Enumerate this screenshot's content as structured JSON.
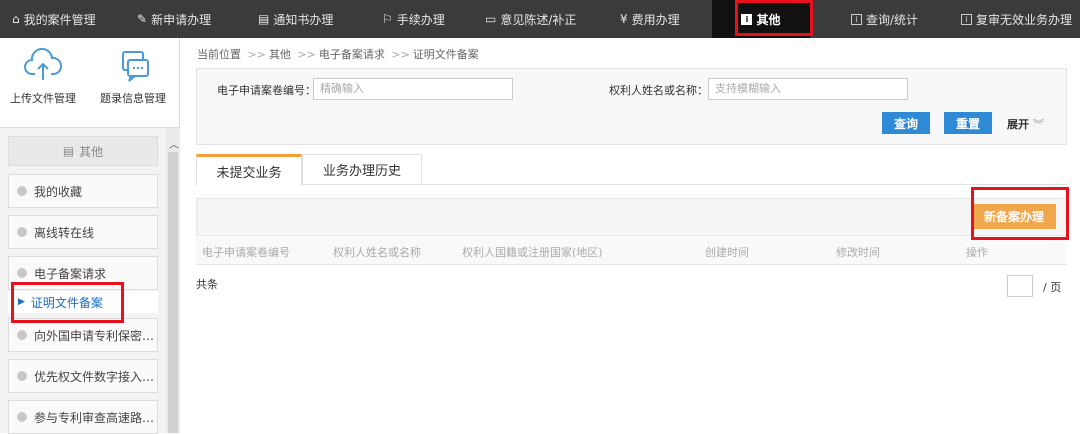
{
  "topnav": {
    "items": [
      {
        "label": "我的案件管理",
        "icon": "home-icon"
      },
      {
        "label": "新申请办理",
        "icon": "edit-icon"
      },
      {
        "label": "通知书办理",
        "icon": "grid-icon"
      },
      {
        "label": "手续办理",
        "icon": "flag-icon"
      },
      {
        "label": "意见陈述/补正",
        "icon": "form-icon"
      },
      {
        "label": "费用办理",
        "icon": "yen-icon"
      },
      {
        "label": "其他",
        "icon": "info-icon"
      },
      {
        "label": "查询/统计",
        "icon": "info-icon"
      },
      {
        "label": "复审无效业务办理",
        "icon": "info-icon"
      }
    ]
  },
  "sidebar": {
    "tools": [
      {
        "label": "上传文件管理",
        "icon": "cloud-upload-icon"
      },
      {
        "label": "题录信息管理",
        "icon": "chat-screen-icon"
      }
    ],
    "section_title": "其他",
    "items": [
      {
        "label": "我的收藏"
      },
      {
        "label": "离线转在线"
      },
      {
        "label": "电子备案请求"
      },
      {
        "label": "向外国申请专利保密…"
      },
      {
        "label": "优先权文件数字接入…"
      },
      {
        "label": "参与专利审查高速路…"
      }
    ],
    "sub_item": "证明文件备案"
  },
  "breadcrumb": {
    "prefix": "当前位置",
    "parts": [
      "其他",
      "电子备案请求",
      "证明文件备案"
    ]
  },
  "search": {
    "field1_label": "电子申请案卷编号：",
    "field1_placeholder": "精确输入",
    "field2_label": "权利人姓名或名称：",
    "field2_placeholder": "支持模糊输入",
    "query_button": "查询",
    "reset_button": "重置",
    "expand_label": "展开"
  },
  "tabs": [
    {
      "label": "未提交业务"
    },
    {
      "label": "业务办理历史"
    }
  ],
  "toolbar": {
    "new_button": "新备案办理"
  },
  "table": {
    "columns": [
      "电子申请案卷编号",
      "权利人姓名或名称",
      "权利人国籍或注册国家(地区)",
      "创建时间",
      "修改时间",
      "操作"
    ]
  },
  "pager": {
    "total": "共条",
    "page_unit": "/ 页"
  },
  "colors": {
    "highlight": "#e8101a",
    "primary": "#2f8ad6",
    "accent": "#f0a64a"
  }
}
